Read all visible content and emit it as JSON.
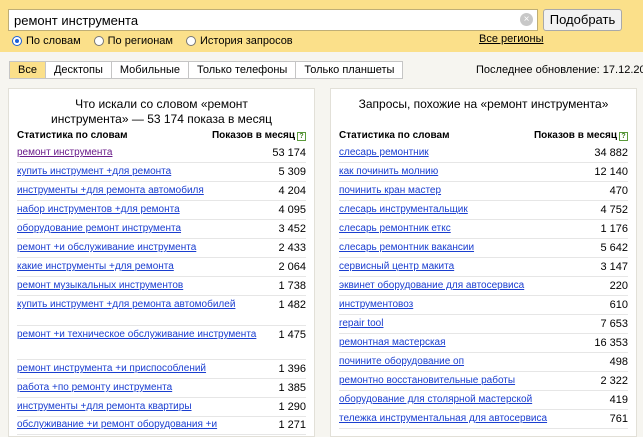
{
  "search": {
    "query": "ремонт инструмента",
    "button_label": "Подобрать",
    "clear_icon": "close-icon",
    "modes": [
      {
        "label": "По словам",
        "checked": true
      },
      {
        "label": "По регионам",
        "checked": false
      },
      {
        "label": "История запросов",
        "checked": false
      }
    ],
    "all_regions": "Все регионы"
  },
  "tabs": [
    "Все",
    "Десктопы",
    "Мобильные",
    "Только телефоны",
    "Только планшеты"
  ],
  "updated": "Последнее обновление: 17.12.2021",
  "left": {
    "title_line1": "Что искали со словом «ремонт",
    "title_line2": "инструмента» — 53 174 показа в месяц",
    "col_label": "Статистика по словам",
    "col_count": "Показов в месяц",
    "help": "?",
    "rows": [
      {
        "q": "ремонт инструмента",
        "n": "53 174",
        "visited": true
      },
      {
        "q": "купить инструмент +для ремонта",
        "n": "5 309"
      },
      {
        "q": "инструменты +для ремонта автомобиля",
        "n": "4 204"
      },
      {
        "q": "набор инструментов +для ремонта",
        "n": "4 095"
      },
      {
        "q": "оборудование ремонт инструмента",
        "n": "3 452"
      },
      {
        "q": "ремонт +и обслуживание инструмента",
        "n": "2 433"
      },
      {
        "q": "какие инструменты +для ремонта",
        "n": "2 064"
      },
      {
        "q": "ремонт музыкальных инструментов",
        "n": "1 738"
      },
      {
        "q": "купить инструмент +для ремонта автомобилей",
        "n": "1 482"
      },
      {
        "q": "ремонт +и техническое обслуживание инструмента",
        "n": "1 475"
      },
      {
        "q": "ремонт инструмента +и приспособлений",
        "n": "1 396"
      },
      {
        "q": "работа +по ремонту инструмента",
        "n": "1 385"
      },
      {
        "q": "инструменты +для ремонта квартиры",
        "n": "1 290"
      },
      {
        "q": "обслуживание +и ремонт оборудования +и",
        "n": "1 271"
      }
    ]
  },
  "right": {
    "title": "Запросы, похожие на «ремонт инструмента»",
    "col_label": "Статистика по словам",
    "col_count": "Показов в месяц",
    "help": "?",
    "rows": [
      {
        "q": "слесарь ремонтник",
        "n": "34 882"
      },
      {
        "q": "как починить молнию",
        "n": "12 140"
      },
      {
        "q": "починить кран мастер",
        "n": "470"
      },
      {
        "q": "слесарь инструментальщик",
        "n": "4 752"
      },
      {
        "q": "слесарь ремонтник еткс",
        "n": "1 176"
      },
      {
        "q": "слесарь ремонтник вакансии",
        "n": "5 642"
      },
      {
        "q": "сервисный центр макита",
        "n": "3 147"
      },
      {
        "q": "эквинет оборудование для автосервиса",
        "n": "220"
      },
      {
        "q": "инструментовоз",
        "n": "610"
      },
      {
        "q": "repair tool",
        "n": "7 653"
      },
      {
        "q": "ремонтная мастерская",
        "n": "16 353"
      },
      {
        "q": "почините оборудование оп",
        "n": "498"
      },
      {
        "q": "ремонтно восстановительные работы",
        "n": "2 322"
      },
      {
        "q": "оборудование для столярной мастерской",
        "n": "419"
      },
      {
        "q": "тележка инструментальная для автосервиса",
        "n": "761"
      }
    ]
  }
}
